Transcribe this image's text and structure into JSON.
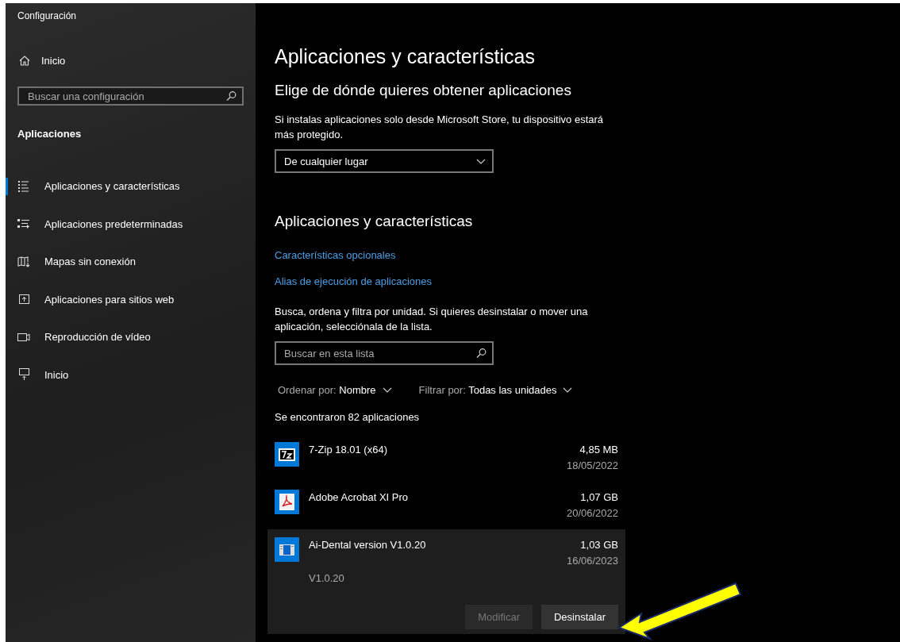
{
  "window": {
    "title": "Configuración"
  },
  "sidebar": {
    "home": "Inicio",
    "search": {
      "placeholder": "Buscar una configuración"
    },
    "section": "Aplicaciones",
    "items": [
      {
        "label": "Aplicaciones y características",
        "kind": "list",
        "selected": true
      },
      {
        "label": "Aplicaciones predeterminadas",
        "kind": "defaults",
        "selected": false
      },
      {
        "label": "Mapas sin conexión",
        "kind": "map",
        "selected": false
      },
      {
        "label": "Aplicaciones para sitios web",
        "kind": "web",
        "selected": false
      },
      {
        "label": "Reproducción de vídeo",
        "kind": "video",
        "selected": false
      },
      {
        "label": "Inicio",
        "kind": "startup",
        "selected": false
      }
    ]
  },
  "main": {
    "title": "Aplicaciones y características",
    "source_heading": "Elige de dónde quieres obtener aplicaciones",
    "source_note": "Si instalas aplicaciones solo desde Microsoft Store, tu dispositivo estará más protegido.",
    "source_dropdown": "De cualquier lugar",
    "apps_heading": "Aplicaciones y características",
    "links": [
      "Características opcionales",
      "Alias de ejecución de aplicaciones"
    ],
    "list_note": "Busca, ordena y filtra por unidad. Si quieres desinstalar o mover una aplicación, selecciónala de la lista.",
    "list_search": {
      "placeholder": "Buscar en esta lista"
    },
    "sort": {
      "label": "Ordenar por:",
      "value": "Nombre"
    },
    "filter": {
      "label": "Filtrar por:",
      "value": "Todas las unidades"
    },
    "count": "Se encontraron 82 aplicaciones",
    "apps": [
      {
        "name": "7-Zip 18.01 (x64)",
        "kind": "archiver",
        "size": "4,85 MB",
        "date": "18/05/2022",
        "selected": false
      },
      {
        "name": "Adobe Acrobat XI Pro",
        "kind": "pdf",
        "size": "1,07 GB",
        "date": "20/06/2022",
        "selected": false
      },
      {
        "name": "Ai-Dental version V1.0.20",
        "kind": "program",
        "size": "1,03 GB",
        "date": "16/06/2023",
        "selected": true,
        "version": "V1.0.20",
        "buttons": [
          {
            "label": "Modificar",
            "disabled": true
          },
          {
            "label": "Desinstalar",
            "disabled": false
          }
        ]
      }
    ]
  }
}
